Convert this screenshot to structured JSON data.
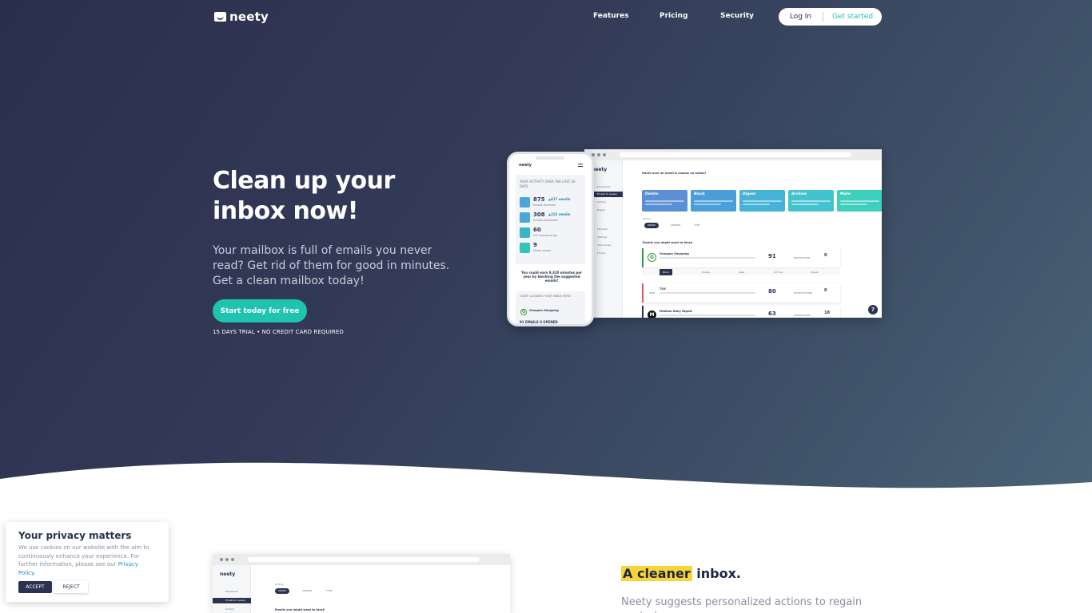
{
  "nav": {
    "logo": "neety",
    "links": [
      "Features",
      "Pricing",
      "Security"
    ],
    "login": "Log In",
    "get_started": "Get started"
  },
  "hero": {
    "title": "Clean up your inbox now!",
    "subtitle": "Your mailbox is full of emails you never read? Get rid of them for good in minutes. Get a clean mailbox today!",
    "cta": "Start today for free",
    "trial_note": "15 DAYS TRIAL • NO CREDIT CARD REQUIRED"
  },
  "desktop_mock": {
    "logo": "neety",
    "sidebar": [
      "Dashboard",
      "Emails to review",
      "Activity",
      "Digest",
      "Premium",
      "Settings",
      "Help Center",
      "Privacy"
    ],
    "prompt": "Hover over an email & choose an action!",
    "actions": [
      {
        "label": "Delete",
        "color": "#5b8fd6"
      },
      {
        "label": "Block",
        "color": "#4a9fd8"
      },
      {
        "label": "Digest",
        "color": "#46b2d6"
      },
      {
        "label": "Archive",
        "color": "#44c3cf"
      },
      {
        "label": "Mute",
        "color": "#3fcfbf"
      }
    ],
    "sort_label": "Sort by",
    "sort_chips": [
      "SMART",
      "SENDER",
      "TYPE"
    ],
    "section_label": "Emails you might want to block",
    "rows": [
      {
        "sender": "Groupon Shopping",
        "count": "91",
        "tag": "PROMOTIONS",
        "num2": "0",
        "bar": "#2e9a3b",
        "avatar": "G",
        "avatar_color": "#2e9a3b"
      },
      {
        "sender": "TUX",
        "count": "80",
        "tag": "NOTIFICATIONS",
        "num2": "0",
        "bar": "#d65a5a",
        "avatar": "TUX",
        "avatar_color": "#7aa35a"
      },
      {
        "sender": "Medium Daily Digest",
        "count": "63",
        "tag": "PROMOTIONS",
        "num2": "18",
        "bar": "#2b3350",
        "avatar": "M",
        "avatar_color": "#111111"
      }
    ],
    "row_actions": [
      "Block",
      "Delete",
      "Keep",
      "Archive",
      "Digest"
    ],
    "help": "?"
  },
  "phone_mock": {
    "logo": "neety",
    "activity_header": "YOUR ACTIVITY OVER THE LAST 30 DAYS",
    "stats": [
      {
        "num": "875",
        "delta": "▲617 emails",
        "label": "Emails received"
      },
      {
        "num": "308",
        "delta": "▲222 emails",
        "label": "Emails processed"
      },
      {
        "num": "60",
        "delta": "",
        "label": "CO₂ economy (g)"
      },
      {
        "num": "9",
        "delta": "",
        "label": "Hours saved"
      }
    ],
    "note": "You could earn 9,320 minutes per year by blocking the suggested emails!",
    "start_header": "START CLEANING YOUR INBOX HERE!",
    "start_sender": "Groupon Shopping",
    "start_footer": "91 EMAILS   0 OPENED"
  },
  "section2": {
    "title_highlight": "A cleaner",
    "title_rest": " inbox.",
    "text": "Neety suggests personalized actions to regain control"
  },
  "cookie": {
    "title": "Your privacy matters",
    "text": "We use cookies on our website with the aim to continuously enhance your experience. For further information, please see our ",
    "link": "Privacy Policy",
    "link_end": ".",
    "accept": "ACCEPT",
    "reject": "REJECT"
  }
}
